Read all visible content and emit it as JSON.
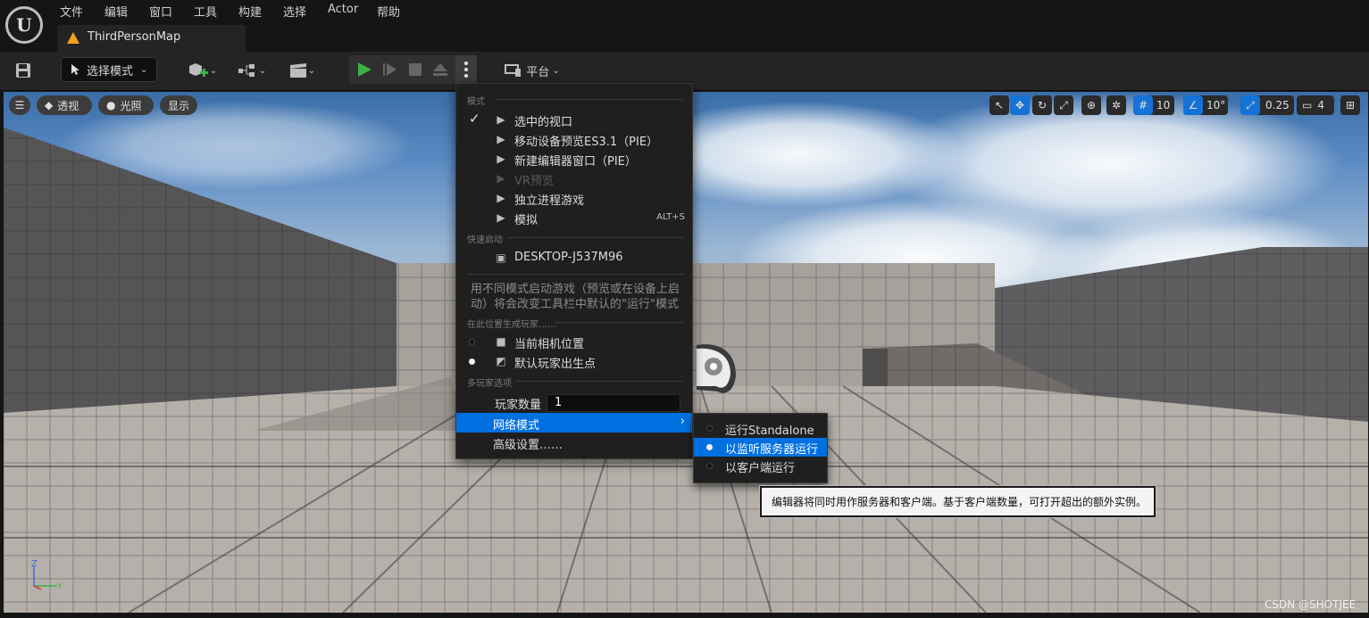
{
  "menubar": {
    "logo": "U",
    "items": [
      "文件",
      "编辑",
      "窗口",
      "工具",
      "构建",
      "选择",
      "Actor",
      "帮助"
    ]
  },
  "tab": {
    "label": "ThirdPersonMap"
  },
  "toolbar": {
    "mode_select": "选择模式",
    "platform": "平台"
  },
  "viewport": {
    "perspective": "透视",
    "lighting": "光照",
    "show": "显示",
    "grid_snap": "10",
    "rotation_snap": "10°",
    "scale_snap": "0.25",
    "camera_speed": "4"
  },
  "dropdown": {
    "section_modes": "模式",
    "modes": [
      {
        "label": "选中的视口",
        "shortcut": "",
        "checked": true,
        "disabled": false
      },
      {
        "label": "移动设备预览ES3.1（PIE）",
        "shortcut": "",
        "checked": false,
        "disabled": false
      },
      {
        "label": "新建编辑器窗口（PIE）",
        "shortcut": "",
        "checked": false,
        "disabled": false
      },
      {
        "label": "VR预览",
        "shortcut": "",
        "checked": false,
        "disabled": true
      },
      {
        "label": "独立进程游戏",
        "shortcut": "",
        "checked": false,
        "disabled": false
      },
      {
        "label": "模拟",
        "shortcut": "ALT+S",
        "checked": false,
        "disabled": false
      }
    ],
    "section_quick": "快速启动",
    "quick_device": "DESKTOP-J537M96",
    "description": "用不同模式启动游戏（预览或在设备上启动）将会改变工具栏中默认的\"运行\"模式",
    "section_spawn": "在此位置生成玩家……",
    "spawn": [
      {
        "label": "当前相机位置",
        "selected": false
      },
      {
        "label": "默认玩家出生点",
        "selected": true
      }
    ],
    "section_multiplayer": "多玩家选项",
    "player_count_label": "玩家数量",
    "player_count_value": "1",
    "net_mode": "网络模式",
    "advanced": "高级设置……"
  },
  "submenu": {
    "items": [
      {
        "label": "运行Standalone",
        "selected": false
      },
      {
        "label": "以监听服务器运行",
        "selected": true
      },
      {
        "label": "以客户端运行",
        "selected": false
      }
    ]
  },
  "tooltip": "编辑器将同时用作服务器和客户端。基于客户端数量，可打开超出的额外实例。",
  "watermark": "CSDN @SHOTJEE",
  "colors": {
    "accent": "#0070E0",
    "play_green": "#3CB043",
    "tab_icon": "#F0A020"
  }
}
